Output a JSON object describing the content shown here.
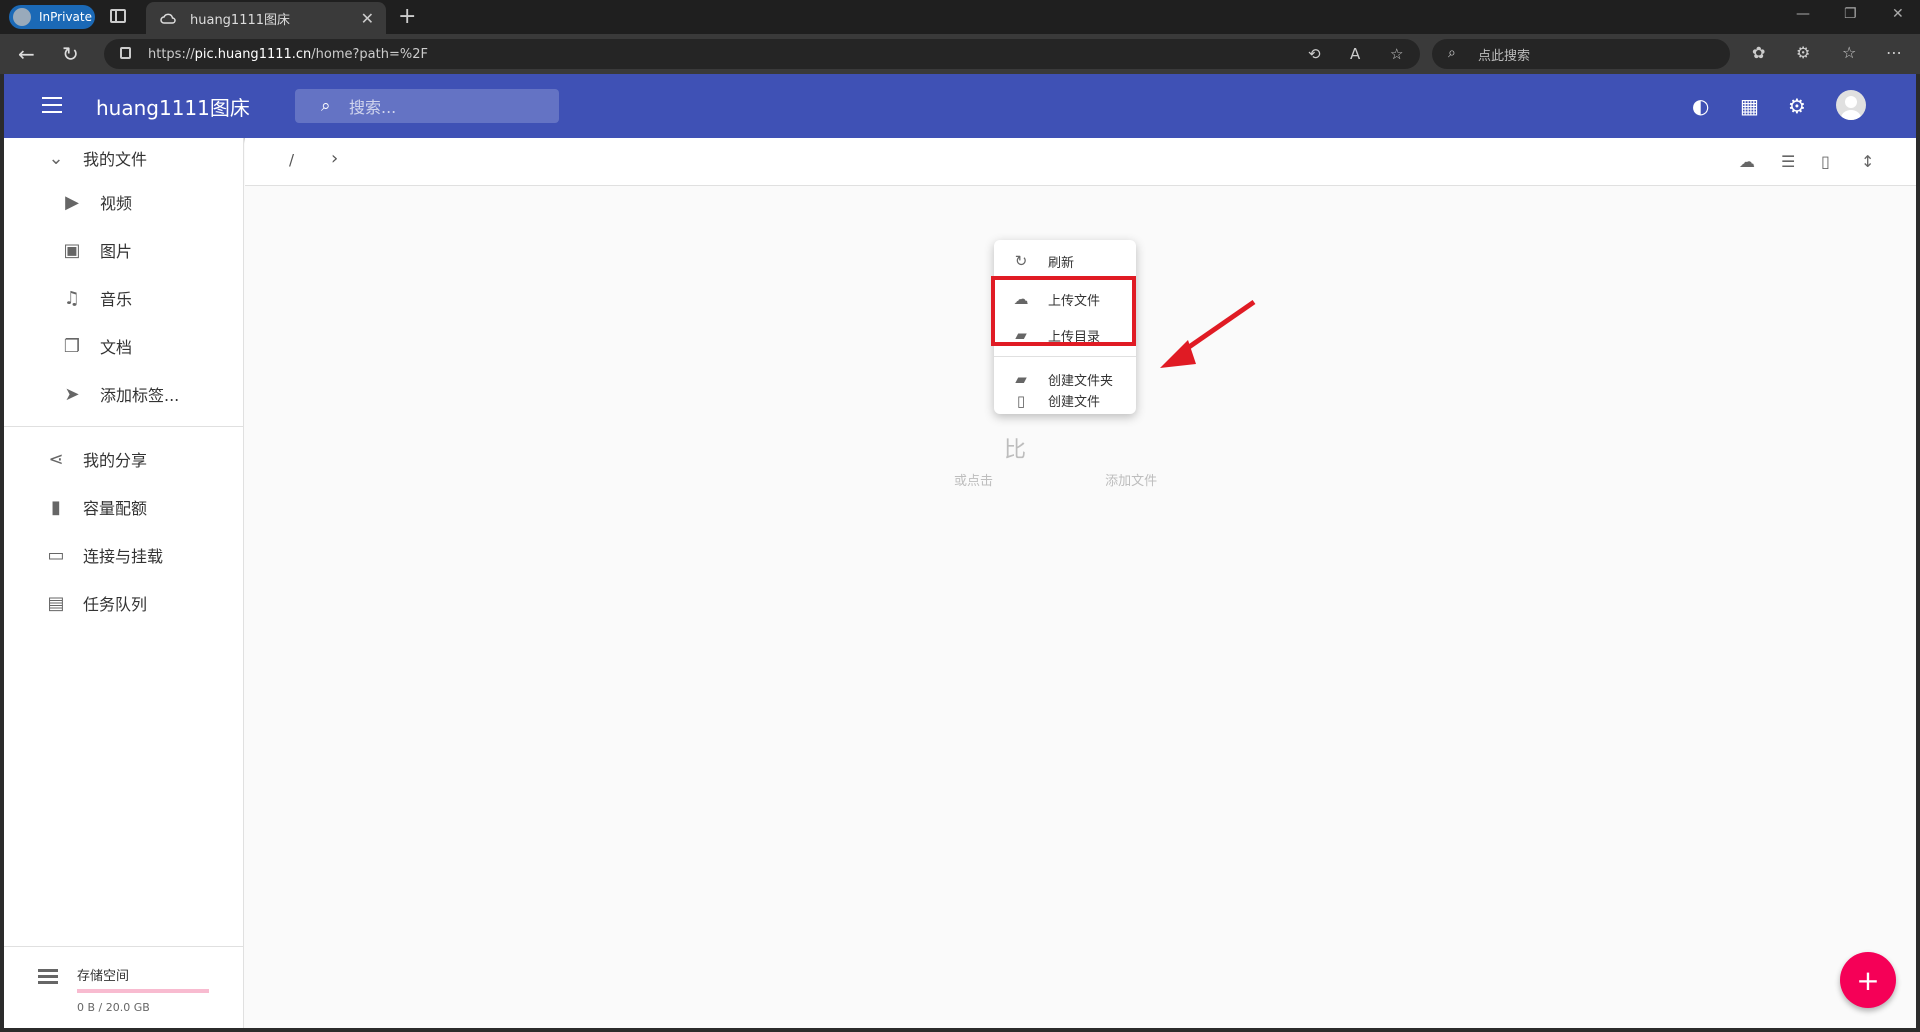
{
  "browser": {
    "inprivate_label": "InPrivate",
    "tab_title": "huang1111图床",
    "url_scheme": "https://",
    "url_host": "pic.huang1111.cn",
    "url_path": "/home?path=%2F",
    "search_placeholder": "点此搜索"
  },
  "appbar": {
    "title": "huang1111图床",
    "search_placeholder": "搜索..."
  },
  "sidebar": {
    "my_files": "我的文件",
    "items": [
      {
        "label": "视频",
        "icon": "video-icon"
      },
      {
        "label": "图片",
        "icon": "image-icon"
      },
      {
        "label": "音乐",
        "icon": "music-icon"
      },
      {
        "label": "文档",
        "icon": "document-icon"
      },
      {
        "label": "添加标签...",
        "icon": "tag-add-icon"
      }
    ],
    "sections": [
      {
        "label": "我的分享",
        "icon": "share-icon"
      },
      {
        "label": "容量配额",
        "icon": "sd-card-icon"
      },
      {
        "label": "连接与挂载",
        "icon": "devices-icon"
      },
      {
        "label": "任务队列",
        "icon": "clipboard-icon"
      }
    ],
    "storage": {
      "label": "存储空间",
      "usage": "0 B / 20.0 GB",
      "used_fraction": 0.0
    }
  },
  "navigator": {
    "root": "/",
    "chevron": "›"
  },
  "empty": {
    "title": "比",
    "subtitle_left": "或点击",
    "subtitle_right": "添加文件"
  },
  "context_menu": {
    "items": [
      {
        "label": "刷新",
        "icon": "refresh-icon"
      },
      {
        "label": "上传文件",
        "icon": "cloud-upload-icon"
      },
      {
        "label": "上传目录",
        "icon": "folder-upload-icon"
      },
      {
        "label": "创建文件夹",
        "icon": "folder-add-icon"
      },
      {
        "label": "创建文件",
        "icon": "file-add-icon"
      }
    ]
  },
  "fab": {
    "label": "+"
  },
  "colors": {
    "appbar": "#3f51b5",
    "fab": "#f50057",
    "highlight": "#e01b24"
  }
}
